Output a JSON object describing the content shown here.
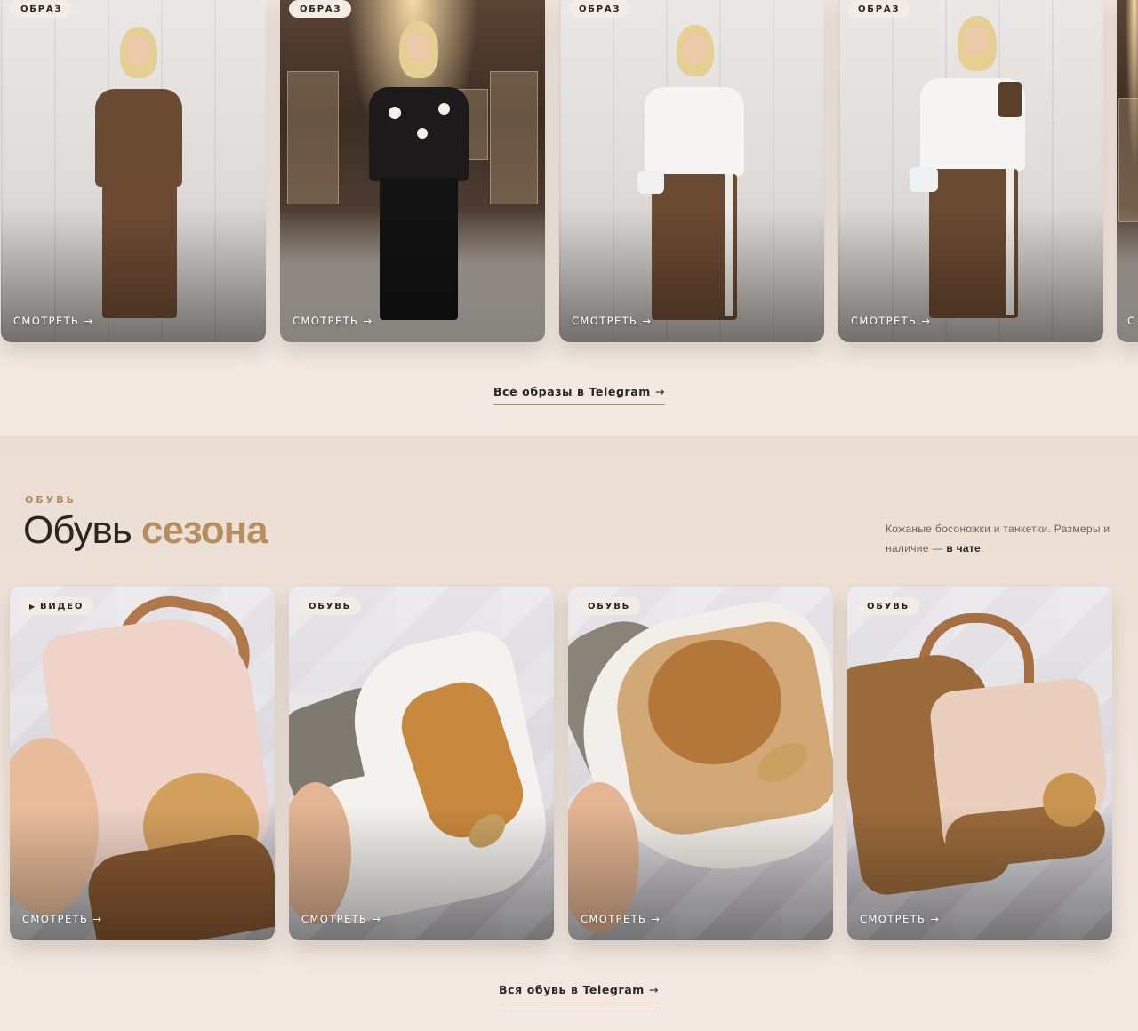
{
  "looks": {
    "cards": [
      {
        "badge": "ОБРАЗ",
        "link": "СМОТРЕТЬ →",
        "scene": "studio",
        "top_color": "#6b4a33",
        "pants_color": "#6d4b33"
      },
      {
        "badge": "ОБРАЗ",
        "link": "СМОТРЕТЬ →",
        "scene": "boutique",
        "top_color": "#1c1a1a",
        "pants_color": "#141313"
      },
      {
        "badge": "ОБРАЗ",
        "link": "СМОТРЕТЬ →",
        "scene": "studio",
        "top_color": "#f6f5f3",
        "pants_color": "#6b4a32"
      },
      {
        "badge": "ОБРАЗ",
        "link": "СМОТРЕТЬ →",
        "scene": "studio",
        "top_color": "#f6f5f3",
        "pants_color": "#6b4a32"
      },
      {
        "badge": "",
        "link": "С",
        "scene": "boutique",
        "top_color": "#1c1a1a",
        "pants_color": "#141313"
      }
    ],
    "all_link": "Все образы в Telegram",
    "arrow": "→"
  },
  "shoes": {
    "label": "ОБУВЬ",
    "title_main": "Обувь ",
    "title_accent": "сезона",
    "desc_before": "Кожаные босоножки и танкетки. Размеры и наличие — ",
    "desc_chat": "в чате",
    "desc_after": ".",
    "cards": [
      {
        "badge_icon": "▶",
        "badge": "ВИДЕО",
        "link": "СМОТРЕТЬ →",
        "upper_color": "#efd3c8",
        "sole_color": "#8a5a32"
      },
      {
        "badge_icon": "",
        "badge": "ОБУВЬ",
        "link": "СМОТРЕТЬ →",
        "upper_color": "#f4f2ee",
        "sole_color": "#7f7a70"
      },
      {
        "badge_icon": "",
        "badge": "ОБУВЬ",
        "link": "СМОТРЕТЬ →",
        "upper_color": "#d2a877",
        "sole_color": "#8a8478"
      },
      {
        "badge_icon": "",
        "badge": "ОБУВЬ",
        "link": "СМОТРЕТЬ →",
        "upper_color": "#ebcfbe",
        "sole_color": "#9a6a3a"
      }
    ],
    "all_link": "Вся обувь в Telegram",
    "arrow": "→"
  },
  "colors": {
    "page_bg": "#f2e9e2",
    "accent": "#b58f60",
    "text": "#2b2622"
  }
}
